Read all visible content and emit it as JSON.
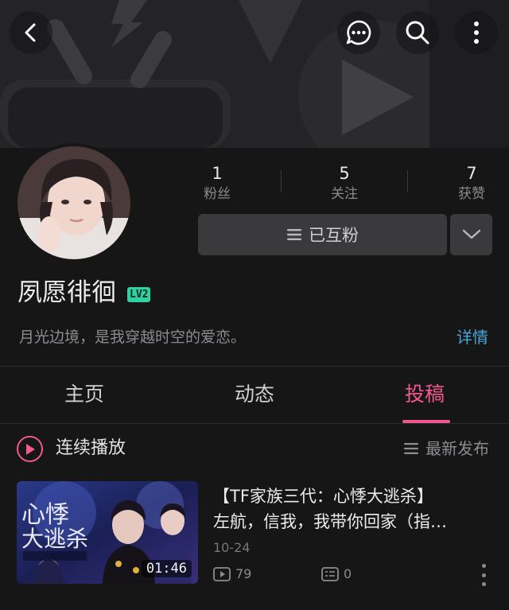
{
  "header": {
    "back_icon": "chevron-left-icon",
    "message_icon": "chat-bubble-icon",
    "search_icon": "search-icon",
    "more_icon": "more-vertical-icon"
  },
  "profile": {
    "name": "夙愿徘徊",
    "level": "LV2",
    "bio": "月光边境，是我穿越时空的爱恋。",
    "details_label": "详情",
    "stats": [
      {
        "value": "1",
        "label": "粉丝"
      },
      {
        "value": "5",
        "label": "关注"
      },
      {
        "value": "7",
        "label": "获赞"
      }
    ],
    "follow_label": "已互粉"
  },
  "tabs": [
    {
      "label": "主页",
      "active": false
    },
    {
      "label": "动态",
      "active": false
    },
    {
      "label": "投稿",
      "active": true
    }
  ],
  "playlist": {
    "label": "连续播放",
    "sort_label": "最新发布"
  },
  "videos": [
    {
      "title_line1": "【TF家族三代：心悸大逃杀】",
      "title_line2": "左航，信我，我带你回家（指…",
      "date": "10-24",
      "duration": "01:46",
      "views": "79",
      "comments": "0"
    }
  ],
  "colors": {
    "accent": "#f1588f",
    "link": "#4aa7d9",
    "level_badge": "#2fd1a0",
    "background": "#161617"
  }
}
